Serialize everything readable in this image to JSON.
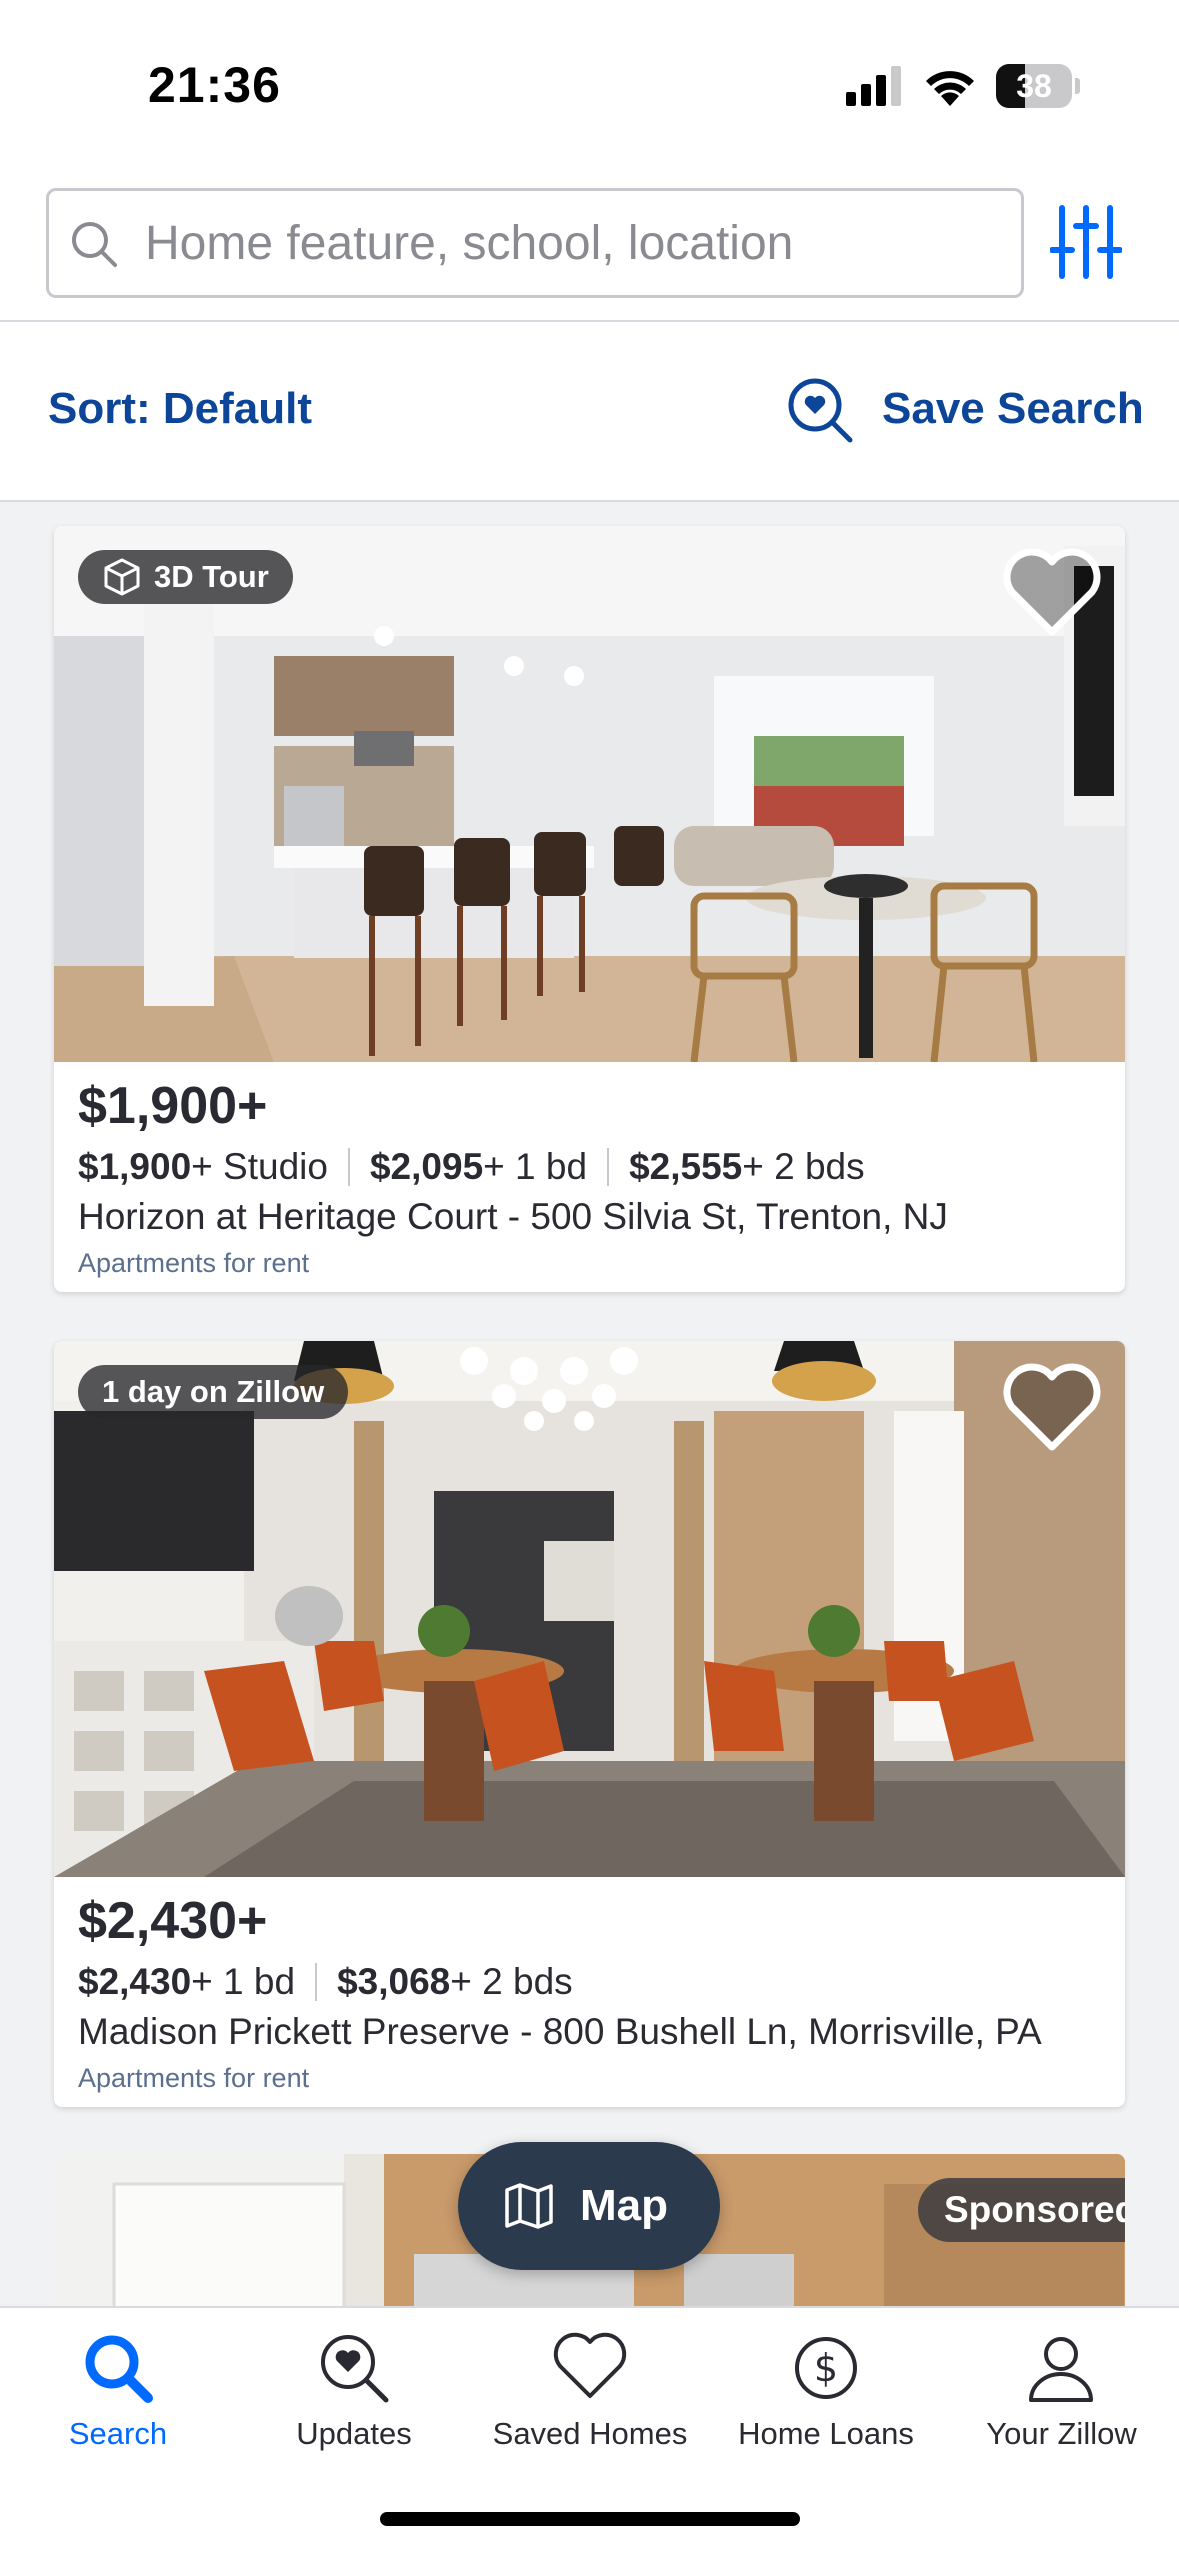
{
  "status_bar": {
    "time": "21:36",
    "battery_level": "38",
    "battery_fraction": 0.38
  },
  "search": {
    "placeholder": "Home feature, school, location",
    "search_icon": "search-icon",
    "filter_icon": "sliders-icon"
  },
  "sort_bar": {
    "sort_label": "Sort: Default",
    "save_search_label": "Save Search",
    "save_search_icon": "search-heart-icon"
  },
  "listings": [
    {
      "badge": "3D Tour",
      "badge_icon": "cube-icon",
      "favorite_icon": "heart-icon",
      "price": "$1,900+",
      "units": [
        {
          "price": "$1,900",
          "suffix": "+ Studio"
        },
        {
          "price": "$2,095",
          "suffix": "+ 1 bd"
        },
        {
          "price": "$2,555",
          "suffix": "+ 2 bds"
        }
      ],
      "address": "Horizon at Heritage Court - 500 Silvia St, Trenton, NJ",
      "type": "Apartments for rent"
    },
    {
      "badge": "1 day on Zillow",
      "favorite_icon": "heart-icon",
      "price": "$2,430+",
      "units": [
        {
          "price": "$2,430",
          "suffix": "+ 1 bd"
        },
        {
          "price": "$3,068",
          "suffix": "+ 2 bds"
        }
      ],
      "address": "Madison Prickett Preserve - 800 Bushell Ln, Morrisville, PA",
      "type": "Apartments for rent"
    },
    {
      "badge": "Sponsored"
    }
  ],
  "map_button": {
    "label": "Map",
    "icon": "map-icon"
  },
  "tab_bar": {
    "active": "Search",
    "items": [
      {
        "label": "Search",
        "icon": "search-icon"
      },
      {
        "label": "Updates",
        "icon": "search-heart-icon"
      },
      {
        "label": "Saved Homes",
        "icon": "heart-icon"
      },
      {
        "label": "Home Loans",
        "icon": "dollar-circle-icon"
      },
      {
        "label": "Your Zillow",
        "icon": "person-icon"
      }
    ]
  },
  "colors": {
    "brand_blue": "#006aff",
    "link_navy": "#0d4599",
    "map_button": "#2c3a4e"
  }
}
